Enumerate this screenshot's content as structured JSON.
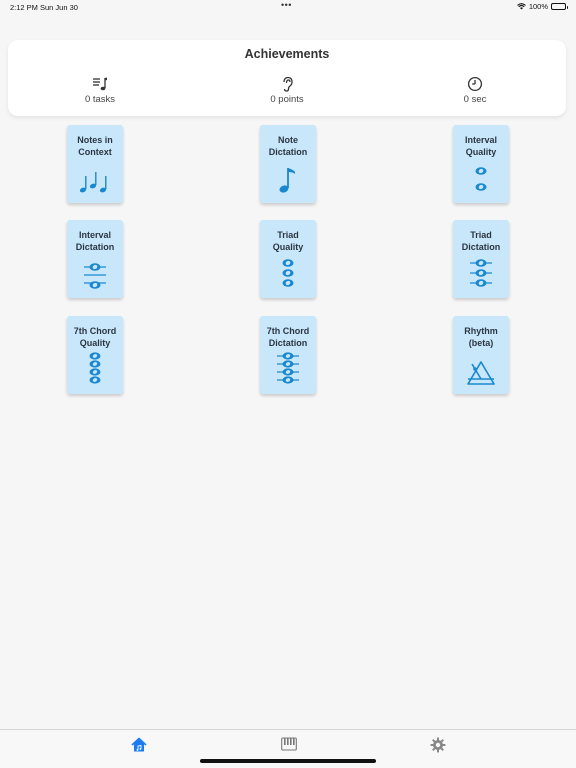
{
  "status_bar": {
    "time": "2:12 PM",
    "date": "Sun Jun 30",
    "dots": "•••",
    "battery": "100%"
  },
  "achievements": {
    "title": "Achievements",
    "stats": [
      {
        "label": "0 tasks",
        "icon": "music-list-icon"
      },
      {
        "label": "0 points",
        "icon": "ear-icon"
      },
      {
        "label": "0 sec",
        "icon": "clock-icon"
      }
    ]
  },
  "tiles": [
    {
      "label": "Notes in\nContext",
      "icon": "three-notes-icon"
    },
    {
      "label": "Note\nDictation",
      "icon": "single-note-icon"
    },
    {
      "label": "Interval\nQuality",
      "icon": "interval-notes-icon"
    },
    {
      "label": "Interval\nDictation",
      "icon": "interval-ledger-icon"
    },
    {
      "label": "Triad\nQuality",
      "icon": "triad-icon"
    },
    {
      "label": "Triad\nDictation",
      "icon": "triad-ledger-icon"
    },
    {
      "label": "7th Chord\nQuality",
      "icon": "seventh-chord-icon"
    },
    {
      "label": "7th Chord\nDictation",
      "icon": "seventh-chord-ledger-icon"
    },
    {
      "label": "Rhythm\n(beta)",
      "icon": "metronome-icon"
    }
  ],
  "tab_bar": {
    "tabs": [
      {
        "name": "home",
        "icon": "home-icon",
        "active": true
      },
      {
        "name": "piano",
        "icon": "piano-icon",
        "active": false
      },
      {
        "name": "settings",
        "icon": "gear-icon",
        "active": false
      }
    ]
  },
  "colors": {
    "tile": "#c8e7fb",
    "accent": "#1a88d0",
    "tab_active": "#1a7cf0"
  }
}
